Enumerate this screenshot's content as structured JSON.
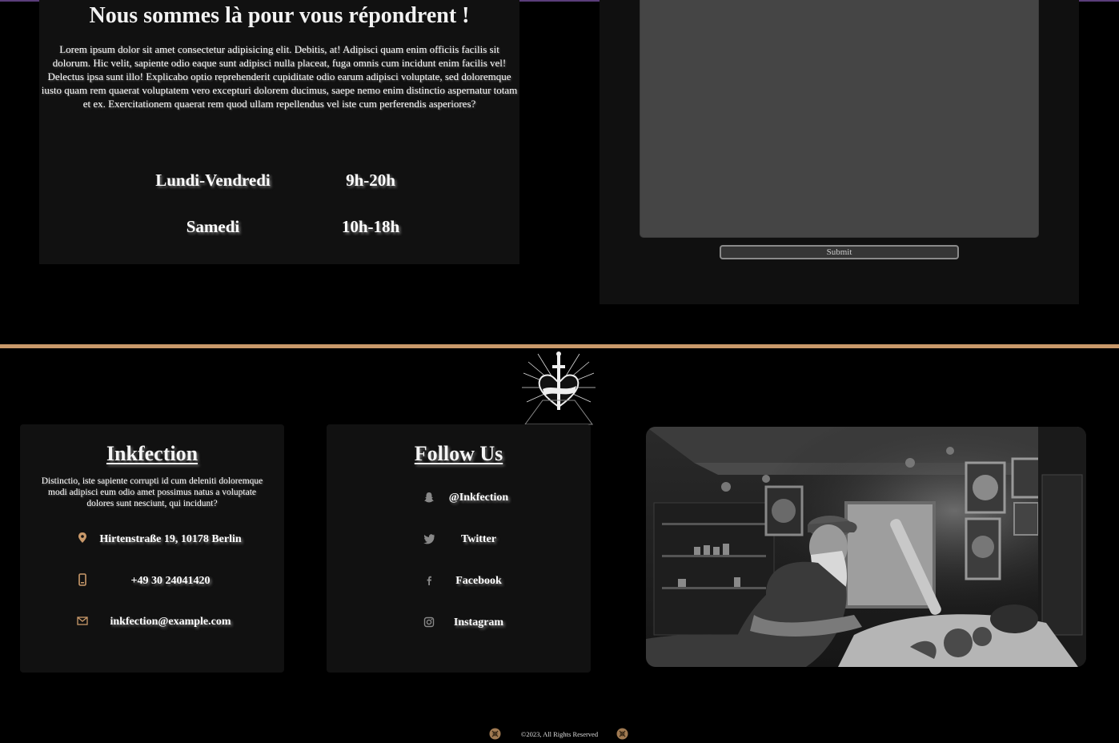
{
  "contact_section": {
    "title": "Nous sommes là pour vous répondrent !",
    "body": "Lorem ipsum dolor sit amet consectetur adipisicing elit. Debitis, at! Adipisci quam enim officiis facilis sit dolorum. Hic velit, sapiente odio eaque sunt adipisci nulla placeat, fuga omnis cum incidunt enim facilis vel! Delectus ipsa sunt illo! Explicabo optio reprehenderit cupiditate odio earum adipisci voluptate, sed doloremque iusto quam rem quaerat voluptatem vero excepturi dolorem ducimus, saepe nemo enim distinctio aspernatur totam et ex. Exercitationem quaerat rem quod ullam repellendus vel iste cum perferendis asperiores?",
    "hours": [
      {
        "day": "Lundi-Vendredi",
        "time": "9h-20h"
      },
      {
        "day": "Samedi",
        "time": "10h-18h"
      }
    ]
  },
  "form": {
    "message_value": "",
    "submit_label": "Submit"
  },
  "footer": {
    "brand": {
      "title": "Inkfection",
      "description": "Distinctio, iste sapiente corrupti id cum deleniti doloremque modi adipisci eum odio amet possimus natus a voluptate dolores sunt nesciunt, qui incidunt?",
      "address": "Hirtenstraße 19, 10178 Berlin",
      "phone": "+49 30 24041420",
      "email": "inkfection@example.com"
    },
    "follow": {
      "title": "Follow Us",
      "items": [
        {
          "icon": "snapchat-icon",
          "label": "@Inkfection"
        },
        {
          "icon": "twitter-icon",
          "label": "Twitter"
        },
        {
          "icon": "facebook-icon",
          "label": "Facebook"
        },
        {
          "icon": "instagram-icon",
          "label": "Instagram"
        }
      ]
    },
    "copyright": "©2023, All Rights Reserved"
  },
  "colors": {
    "background": "#000000",
    "card": "#111111",
    "accent_divider": "#c9996a",
    "icon_accent": "#c9996a",
    "top_line": "#5a3d7a"
  }
}
